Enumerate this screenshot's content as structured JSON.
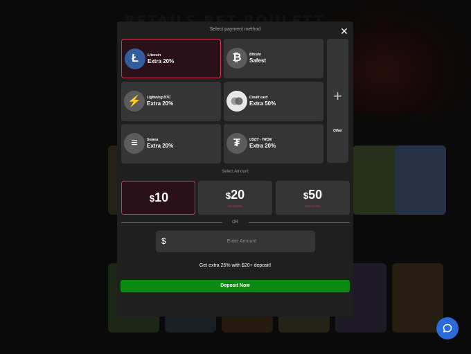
{
  "background": {
    "title": "RETAILS BET ROULETTE"
  },
  "modal": {
    "title": "Select payment method",
    "close_label": "✕",
    "payment_methods": [
      {
        "name": "Litecoin",
        "subtitle": "Extra 20%",
        "icon": "litecoin-icon",
        "glyph": "Ł",
        "selected": true
      },
      {
        "name": "Bitcoin",
        "subtitle": "Safest",
        "icon": "bitcoin-icon",
        "glyph": "₿",
        "selected": false
      },
      {
        "name": "Lightning BTC",
        "subtitle": "Extra 20%",
        "icon": "lightning-icon",
        "glyph": "⚡",
        "selected": false
      },
      {
        "name": "Credit card",
        "subtitle": "Extra 50%",
        "icon": "credit-card-icon",
        "glyph": "",
        "selected": false
      },
      {
        "name": "Solana",
        "subtitle": "Extra 20%",
        "icon": "solana-icon",
        "glyph": "≡",
        "selected": false
      },
      {
        "name": "USDT - TRON",
        "subtitle": "Extra 20%",
        "icon": "tether-icon",
        "glyph": "₮",
        "selected": false
      }
    ],
    "other": {
      "label": "Other",
      "glyph": "+"
    },
    "amount_section_label": "Select Amount",
    "amounts": [
      {
        "currency": "$",
        "value": "10",
        "extra": "",
        "selected": true
      },
      {
        "currency": "$",
        "value": "20",
        "extra": "5% EXTRA",
        "selected": false
      },
      {
        "currency": "$",
        "value": "50",
        "extra": "15% EXTRA",
        "selected": false
      }
    ],
    "or_label": "OR",
    "amount_input": {
      "currency_symbol": "$",
      "placeholder": "Enter Amount",
      "value": ""
    },
    "promo_text": "Get extra 25% with $20+ deposit!",
    "deposit_label": "Deposit Now"
  },
  "colors": {
    "accent": "#d3365b",
    "deposit": "#0a8a11",
    "chat": "#2a6ad9",
    "litecoin": "#345d9d"
  }
}
